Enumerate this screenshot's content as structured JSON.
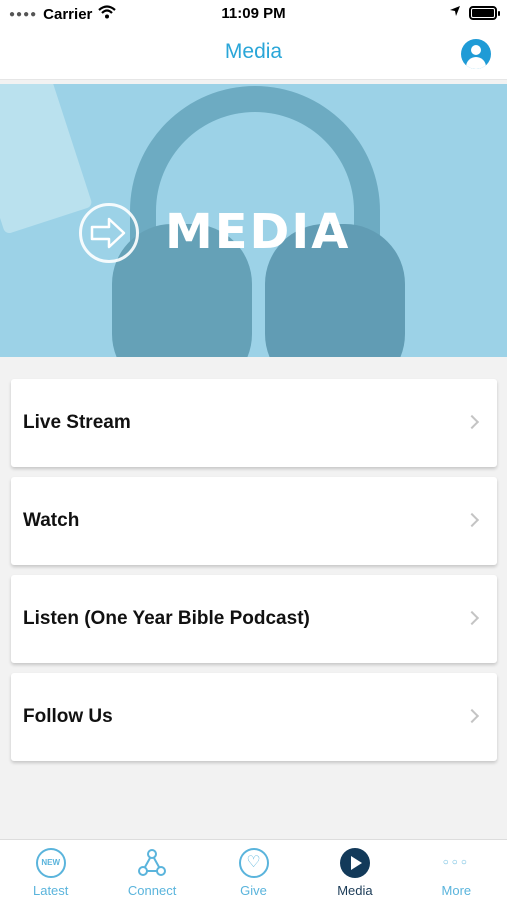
{
  "status_bar": {
    "carrier": "Carrier",
    "time": "11:09 PM"
  },
  "nav": {
    "title": "Media"
  },
  "hero": {
    "title": "MEDIA"
  },
  "menu": {
    "items": [
      {
        "label": "Live Stream"
      },
      {
        "label": "Watch"
      },
      {
        "label": "Listen (One Year Bible Podcast)"
      },
      {
        "label": "Follow Us"
      }
    ]
  },
  "tab_bar": {
    "tabs": [
      {
        "label": "Latest",
        "icon": "new-icon",
        "badge": "NEW"
      },
      {
        "label": "Connect",
        "icon": "connect-icon"
      },
      {
        "label": "Give",
        "icon": "give-icon"
      },
      {
        "label": "Media",
        "icon": "media-play-icon",
        "active": true
      },
      {
        "label": "More",
        "icon": "more-icon"
      }
    ]
  },
  "colors": {
    "accent": "#2aa6d8",
    "tab_inactive": "#5ab4dc",
    "tab_active": "#1b3b57",
    "hero_bg": "#a8d9ec"
  }
}
